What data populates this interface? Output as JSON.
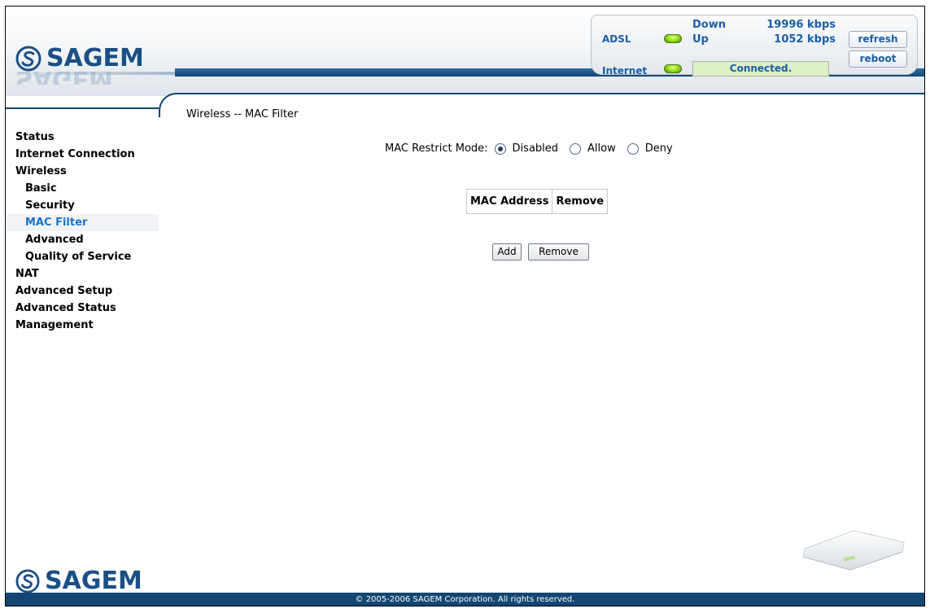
{
  "brand": {
    "logo_text": "SAGEM"
  },
  "status": {
    "adsl_label": "ADSL",
    "internet_label": "Internet",
    "down_label": "Down",
    "down_value": "19996 kbps",
    "up_label": "Up",
    "up_value": "1052 kbps",
    "connection_text": "Connected.",
    "refresh_label": "refresh",
    "reboot_label": "reboot",
    "led_color": "#8bd414"
  },
  "nav": {
    "items": [
      {
        "label": "Status"
      },
      {
        "label": "Internet Connection"
      },
      {
        "label": "Wireless"
      },
      {
        "label": "Basic"
      },
      {
        "label": "Security"
      },
      {
        "label": "MAC Filter"
      },
      {
        "label": "Advanced"
      },
      {
        "label": "Quality of Service"
      },
      {
        "label": "NAT"
      },
      {
        "label": "Advanced Setup"
      },
      {
        "label": "Advanced Status"
      },
      {
        "label": "Management"
      }
    ],
    "active": "MAC Filter"
  },
  "main": {
    "title": "Wireless -- MAC Filter",
    "mode_label": "MAC Restrict Mode:",
    "modes": [
      {
        "label": "Disabled",
        "checked": true
      },
      {
        "label": "Allow",
        "checked": false
      },
      {
        "label": "Deny",
        "checked": false
      }
    ],
    "table_headers": [
      "MAC Address",
      "Remove"
    ],
    "add_label": "Add",
    "remove_label": "Remove"
  },
  "footer": {
    "copyright": "© 2005-2006 SAGEM Corporation. All rights reserved."
  },
  "colors": {
    "brand_blue": "#124673",
    "link_blue": "#1a5ea8",
    "active_blue": "#1a73c8"
  }
}
